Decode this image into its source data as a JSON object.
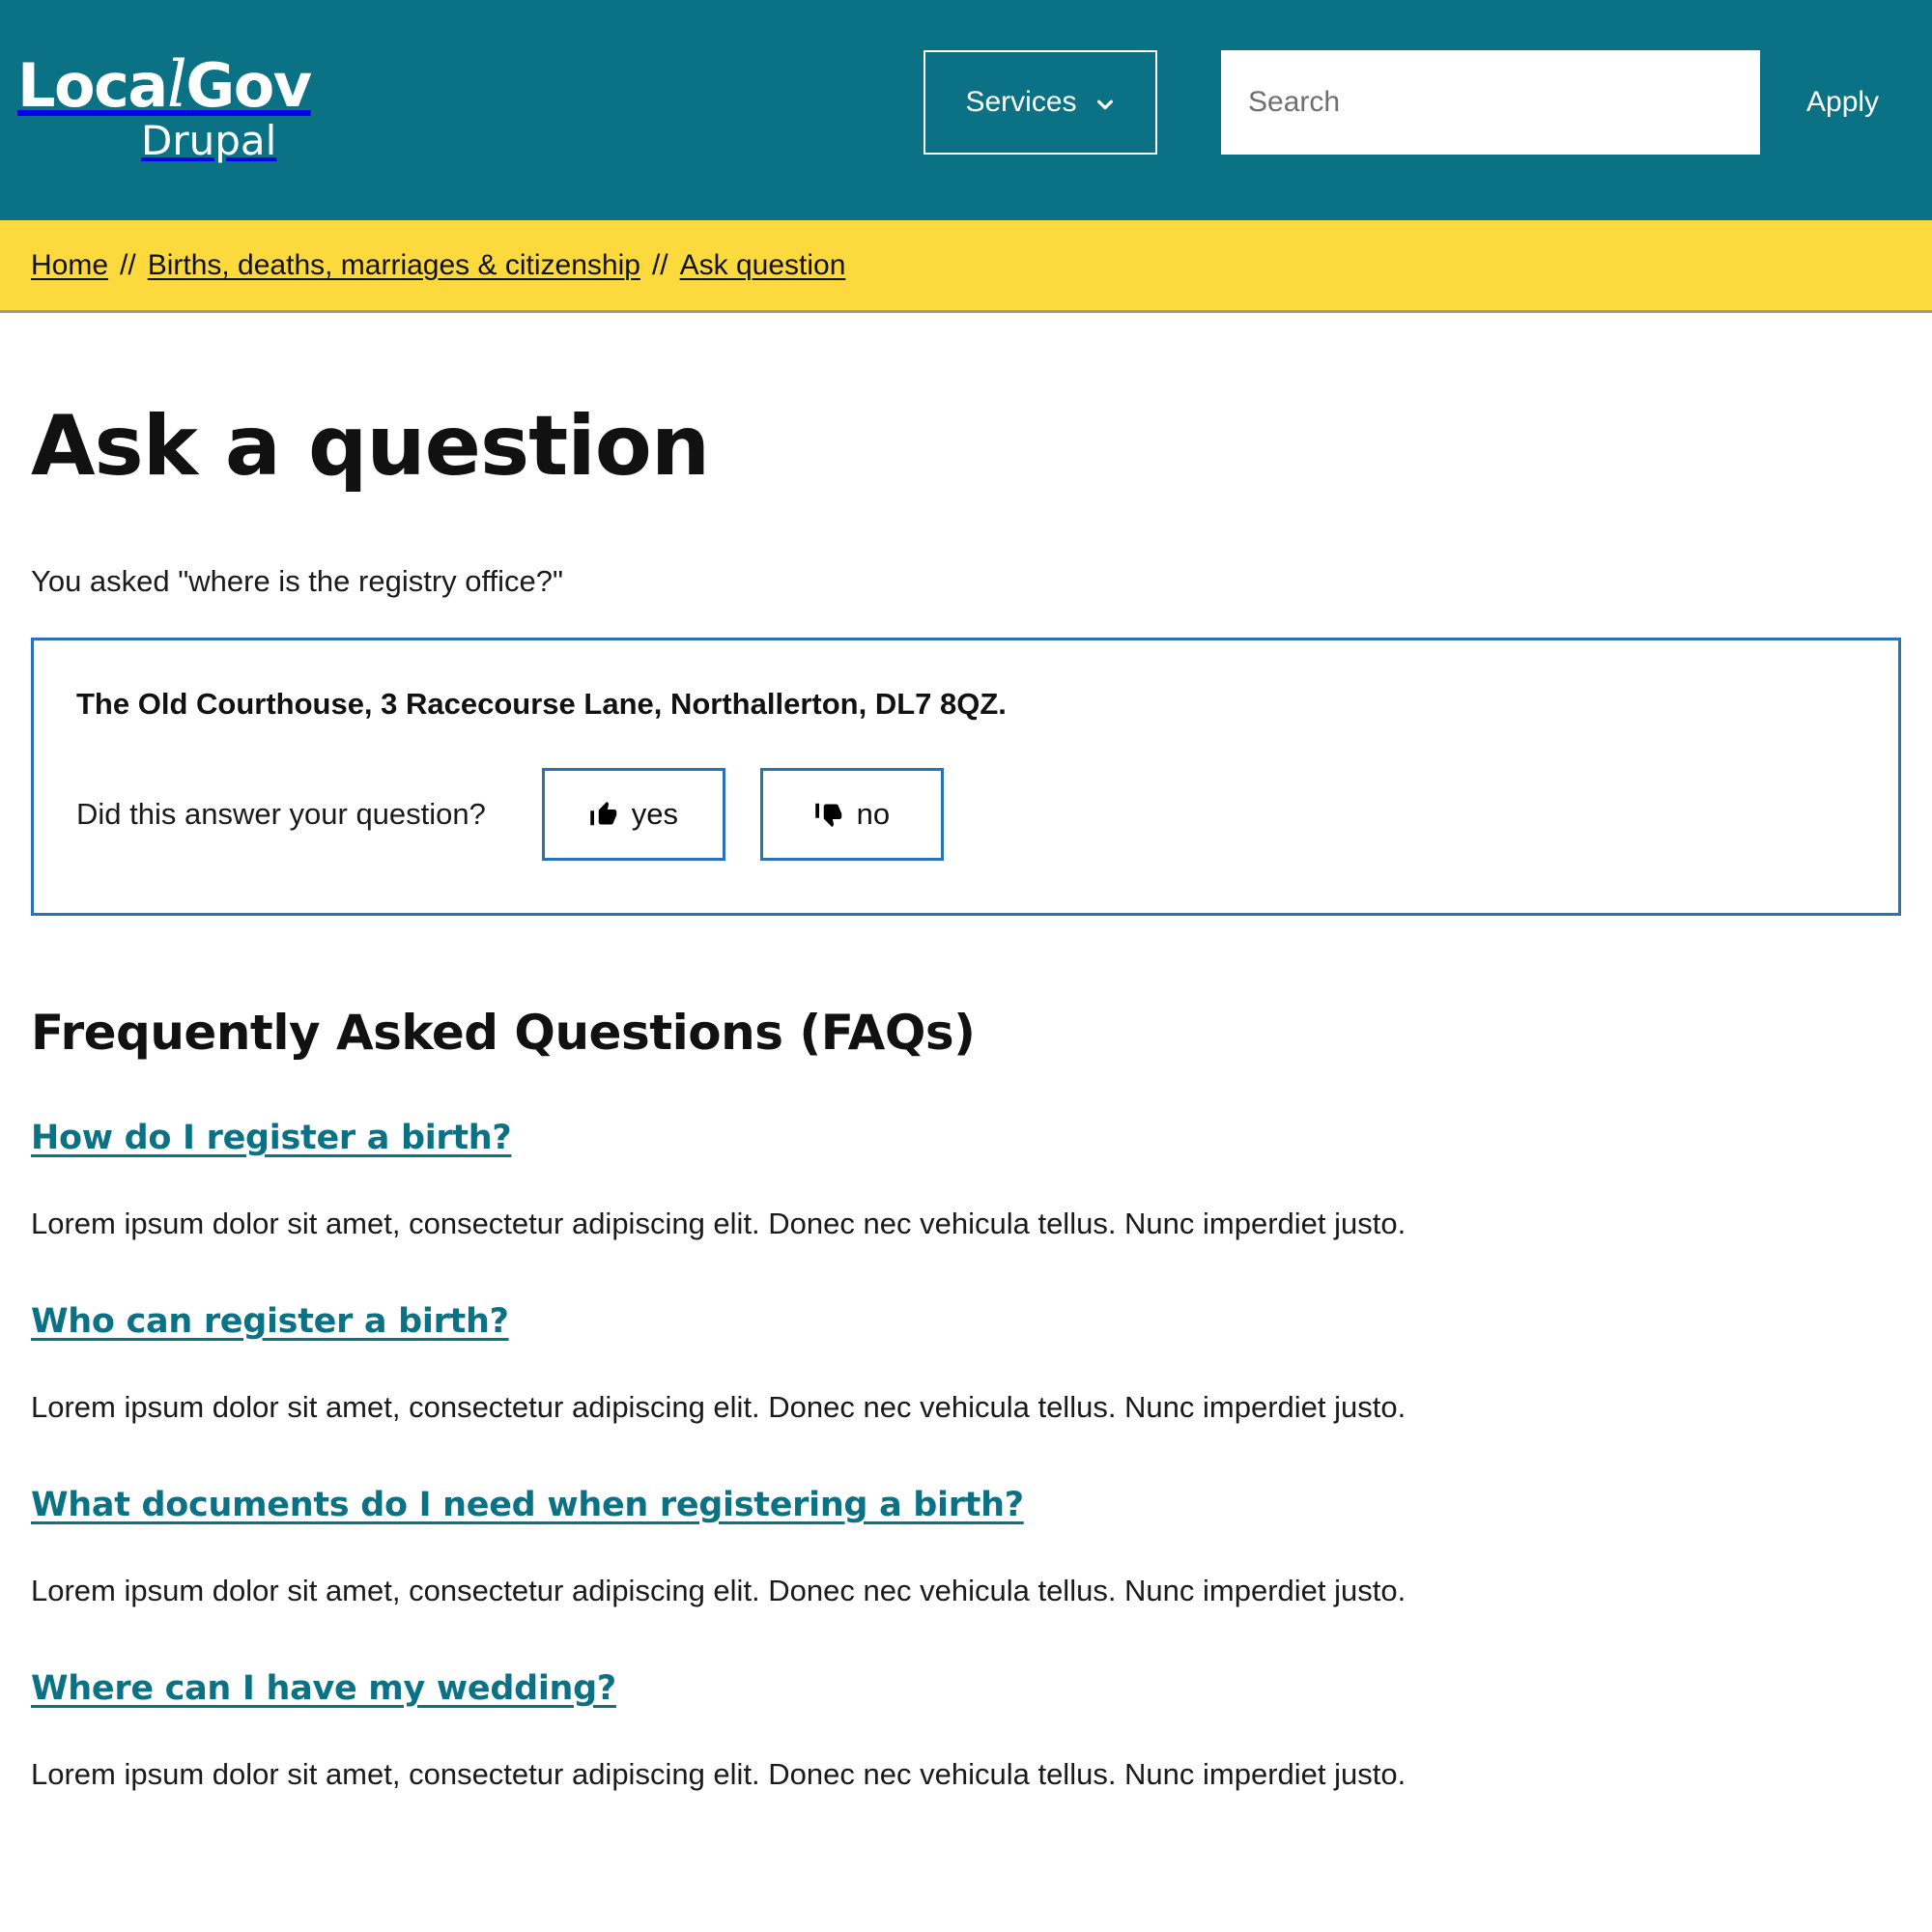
{
  "header": {
    "logo": {
      "primary_pre": "Loca",
      "primary_script": "l",
      "primary_post": "Gov",
      "secondary": "Drupal"
    },
    "services_button": "Services",
    "services_icon": "chevron-down-icon",
    "search_placeholder": "Search",
    "search_value": "",
    "apply_button": "Apply",
    "background_color": "#0b7285"
  },
  "breadcrumb": {
    "separator": "//",
    "background_color": "#fcd93c",
    "items": [
      {
        "label": "Home"
      },
      {
        "label": "Births, deaths, marriages & citizenship"
      },
      {
        "label": "Ask question"
      }
    ]
  },
  "main": {
    "page_title": "Ask a question",
    "asked_line": "You asked \"where is the registry office?\"",
    "answer_panel": {
      "border_color": "#2872b8",
      "answer_text": "The Old Courthouse, 3 Racecourse Lane, Northallerton, DL7 8QZ.",
      "feedback_label": "Did this answer your question?",
      "yes_button": "yes",
      "yes_icon": "thumbs-up-icon",
      "no_button": "no",
      "no_icon": "thumbs-down-icon"
    },
    "faq": {
      "heading": "Frequently Asked Questions (FAQs)",
      "link_color": "#0b7285",
      "items": [
        {
          "question": "How do I register a birth?",
          "answer": "Lorem ipsum dolor sit amet, consectetur adipiscing elit. Donec nec vehicula tellus. Nunc imperdiet justo."
        },
        {
          "question": "Who can register a birth?",
          "answer": "Lorem ipsum dolor sit amet, consectetur adipiscing elit. Donec nec vehicula tellus. Nunc imperdiet justo."
        },
        {
          "question": "What documents do I need when registering a birth?",
          "answer": "Lorem ipsum dolor sit amet, consectetur adipiscing elit. Donec nec vehicula tellus. Nunc imperdiet justo."
        },
        {
          "question": "Where can I have my wedding?",
          "answer": "Lorem ipsum dolor sit amet, consectetur adipiscing elit. Donec nec vehicula tellus. Nunc imperdiet justo."
        }
      ]
    }
  }
}
